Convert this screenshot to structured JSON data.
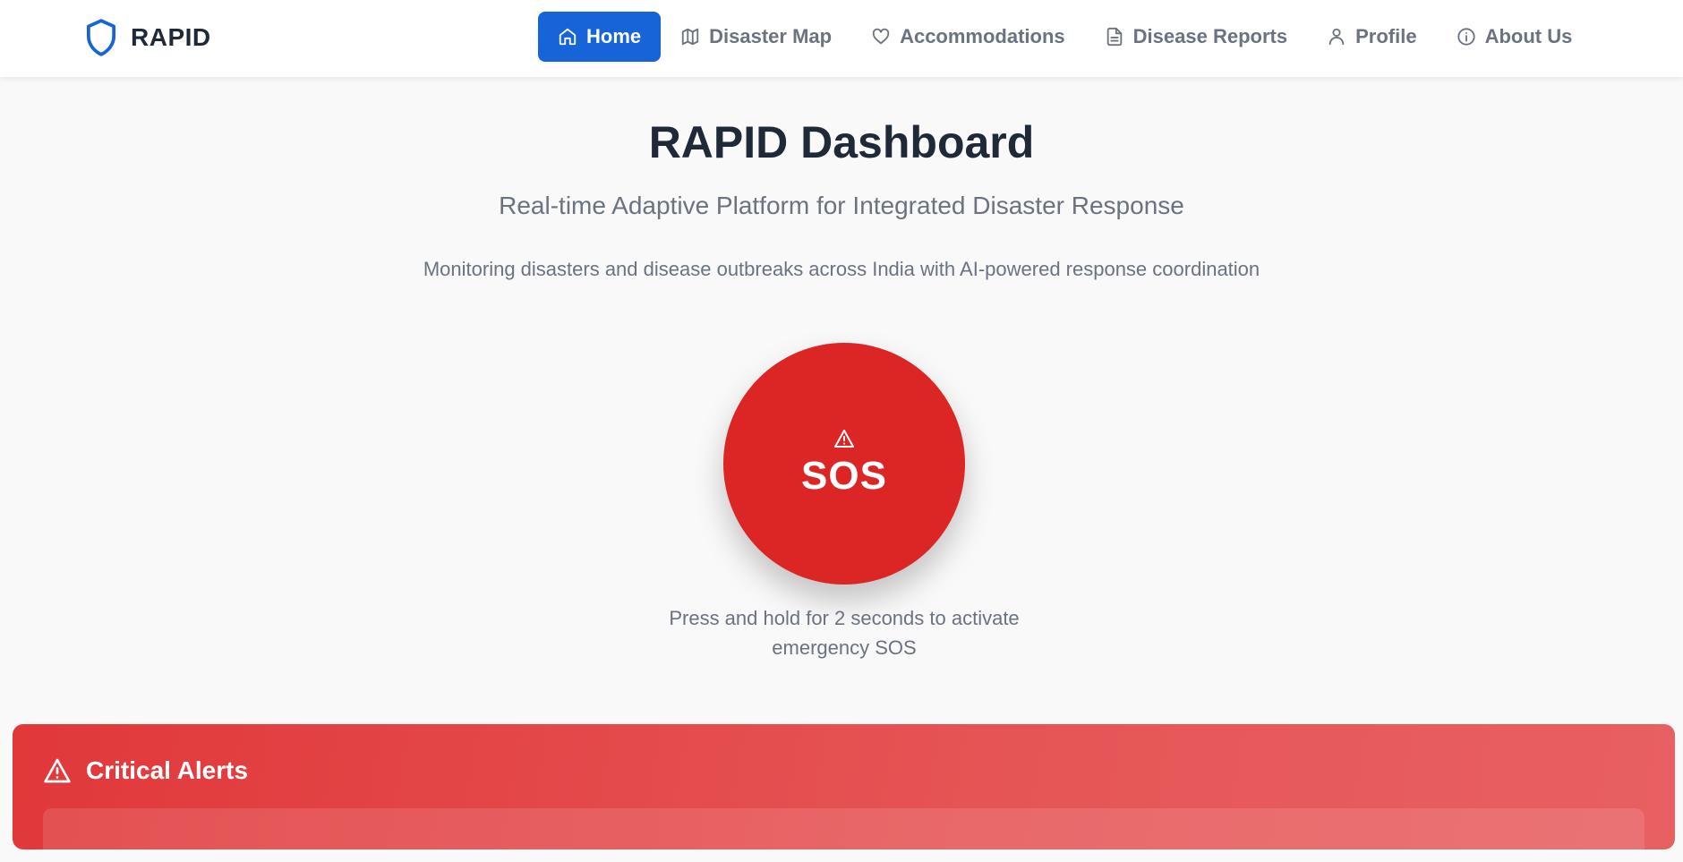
{
  "brand": {
    "name": "RAPID",
    "icon": "shield-icon",
    "color": "#1664d8"
  },
  "nav": [
    {
      "label": "Home",
      "icon": "home-icon",
      "active": true
    },
    {
      "label": "Disaster Map",
      "icon": "map-icon",
      "active": false
    },
    {
      "label": "Accommodations",
      "icon": "heart-icon",
      "active": false
    },
    {
      "label": "Disease Reports",
      "icon": "file-text-icon",
      "active": false
    },
    {
      "label": "Profile",
      "icon": "user-icon",
      "active": false
    },
    {
      "label": "About Us",
      "icon": "info-icon",
      "active": false
    }
  ],
  "hero": {
    "title": "RAPID Dashboard",
    "subtitle": "Real-time Adaptive Platform for Integrated Disaster Response",
    "description": "Monitoring disasters and disease outbreaks across India with AI-powered response coordination"
  },
  "sos": {
    "label": "SOS",
    "icon": "alert-triangle-icon",
    "color": "#dc2626",
    "hint": "Press and hold for 2 seconds to activate emergency SOS"
  },
  "alerts": {
    "title": "Critical Alerts",
    "icon": "alert-triangle-icon",
    "color": "#e1383a"
  }
}
